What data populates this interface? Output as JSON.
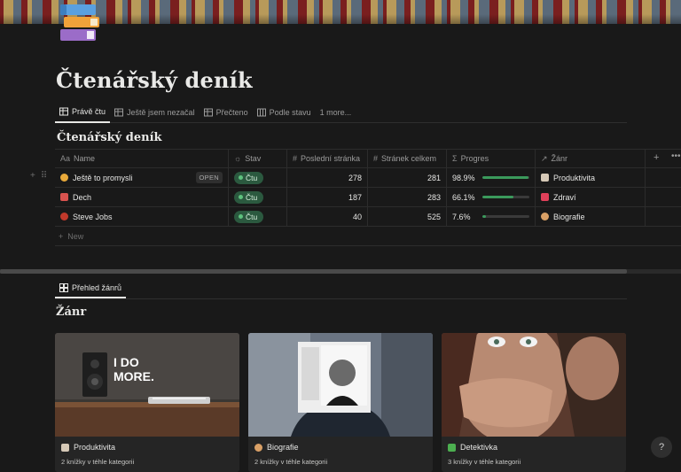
{
  "page": {
    "title": "Čtenářský deník"
  },
  "views": {
    "tabs": [
      {
        "label": "Právě čtu",
        "icon": "table-icon",
        "active": true
      },
      {
        "label": "Ještě jsem nezačal",
        "icon": "table-icon",
        "active": false
      },
      {
        "label": "Přečteno",
        "icon": "table-icon",
        "active": false
      },
      {
        "label": "Podle stavu",
        "icon": "board-icon",
        "active": false
      },
      {
        "label": "1 more...",
        "icon": "",
        "active": false
      }
    ]
  },
  "database": {
    "title": "Čtenářský deník",
    "columns": {
      "name": "Name",
      "name_icon": "Aa",
      "stav": "Stav",
      "posledni": "Poslední stránka",
      "celkem": "Stránek celkem",
      "progres": "Progres",
      "zanr": "Žánr"
    },
    "open_label": "OPEN",
    "rows": [
      {
        "name": "Ještě to promysli",
        "emoji_color": "#e8a93a",
        "stav": "Čtu",
        "posledni": "278",
        "celkem": "281",
        "progres_label": "98.9%",
        "progres": 0.989,
        "zanr": "Produktivita",
        "zanr_color": "#d6c9b7"
      },
      {
        "name": "Dech",
        "emoji_color": "#d9534f",
        "stav": "Čtu",
        "posledni": "187",
        "celkem": "283",
        "progres_label": "66.1%",
        "progres": 0.661,
        "zanr": "Zdraví",
        "zanr_color": "#e0405a"
      },
      {
        "name": "Steve Jobs",
        "emoji_color": "#c0392b",
        "stav": "Čtu",
        "posledni": "40",
        "celkem": "525",
        "progres_label": "7.6%",
        "progres": 0.076,
        "zanr": "Biografie",
        "zanr_color": "#d9a066"
      }
    ],
    "new_label": "New"
  },
  "gallery": {
    "tab_label": "Přehled žánrů",
    "title": "Žánr",
    "cards": [
      {
        "label": "Produktivita",
        "count": "2 knížky v téhle kategorii",
        "image_text_1": "I DO",
        "image_text_2": "MORE."
      },
      {
        "label": "Biografie",
        "count": "2 knížky v téhle kategorii"
      },
      {
        "label": "Detektivka",
        "count": "3 knížky v téhle kategorii"
      }
    ]
  },
  "help_label": "?",
  "colors": {
    "status_green": "#2b593f",
    "progress_green": "#3b9a5c",
    "background": "#191919"
  }
}
